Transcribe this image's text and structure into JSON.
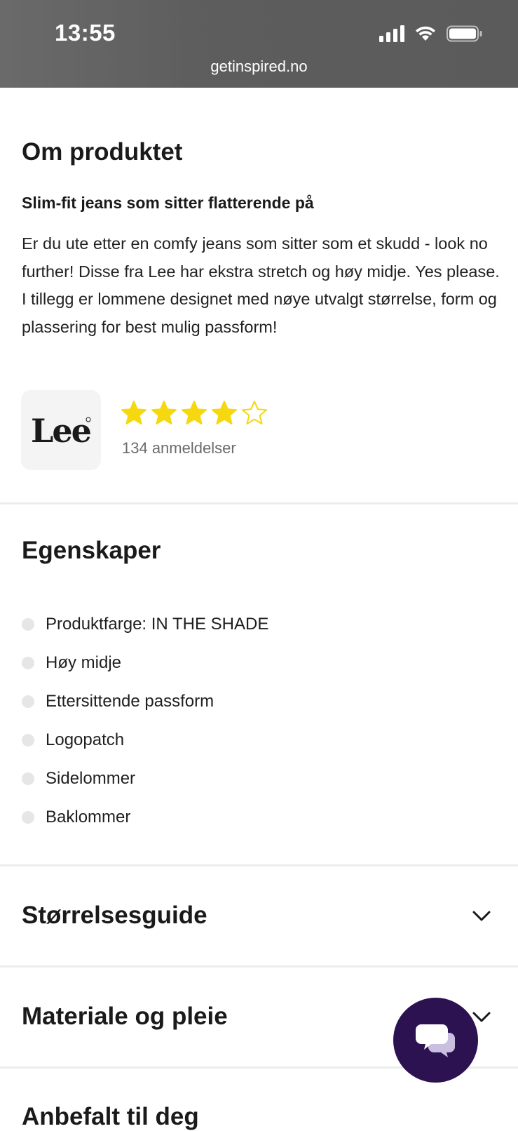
{
  "status_bar": {
    "time": "13:55",
    "url": "getinspired.no",
    "icons": [
      "signal-icon",
      "wifi-icon",
      "battery-icon"
    ]
  },
  "about": {
    "title": "Om produktet",
    "subtitle": "Slim-fit jeans som sitter flatterende på",
    "description": "Er du ute etter en comfy jeans som sitter som et skudd - look no further! Disse fra Lee har ekstra stretch og høy midje. Yes please. I tillegg er lommene designet med nøye utvalgt størrelse, form og plassering for best mulig passform!",
    "brand_logo_text": "Lee",
    "rating": {
      "value": 4,
      "max": 5,
      "color": "#f5d80f"
    },
    "reviews": "134 anmeldelser"
  },
  "features": {
    "title": "Egenskaper",
    "items": [
      "Produktfarge: IN THE SHADE",
      "Høy midje",
      "Ettersittende passform",
      "Logopatch",
      "Sidelommer",
      "Baklommer"
    ]
  },
  "accordions": [
    {
      "title": "Størrelsesguide",
      "icon": "chevron-down-icon"
    },
    {
      "title": "Materiale og pleie",
      "icon": "chevron-down-icon"
    }
  ],
  "recommended": {
    "title": "Anbefalt til deg"
  },
  "chat": {
    "icon": "chat-icon",
    "color": "#2c1250"
  }
}
